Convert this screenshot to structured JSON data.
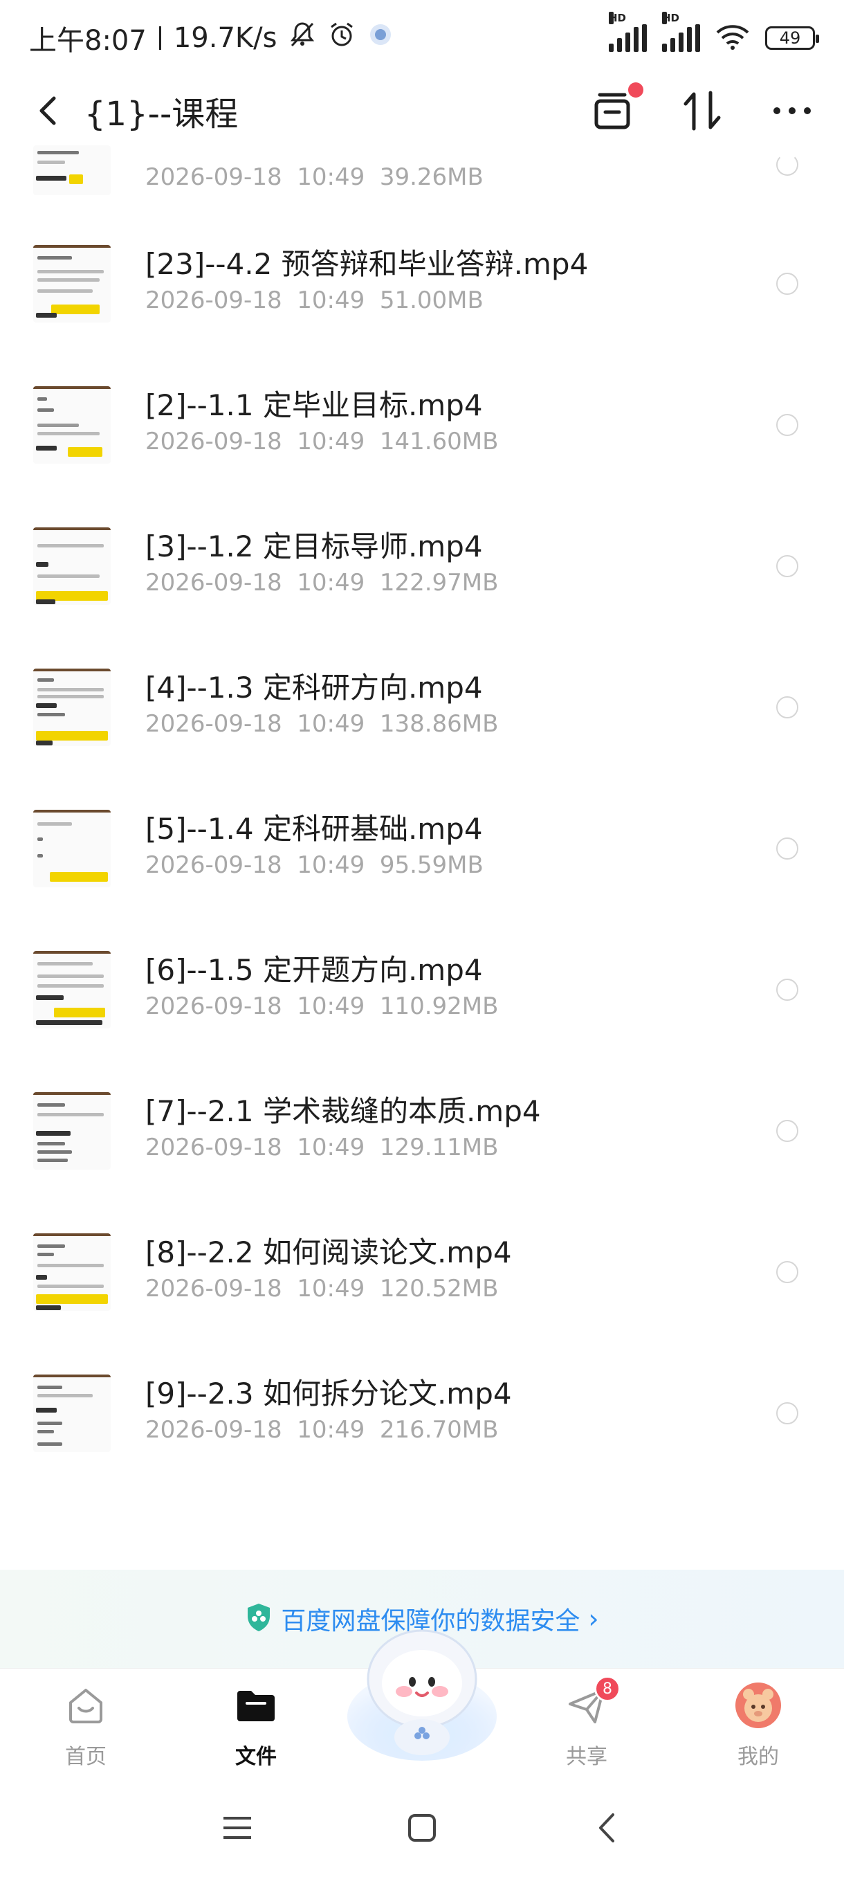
{
  "status_bar": {
    "time": "上午8:07",
    "speed": "19.7K/s",
    "hd1": "HD",
    "hd2": "HD",
    "battery": "49"
  },
  "header": {
    "title": "{1}--课程"
  },
  "files": [
    {
      "name": "",
      "date": "2026-09-18",
      "time": "10:49",
      "size": "39.26MB"
    },
    {
      "name": "[23]--4.2 预答辩和毕业答辩.mp4",
      "date": "2026-09-18",
      "time": "10:49",
      "size": "51.00MB"
    },
    {
      "name": "[2]--1.1 定毕业目标.mp4",
      "date": "2026-09-18",
      "time": "10:49",
      "size": "141.60MB"
    },
    {
      "name": "[3]--1.2 定目标导师.mp4",
      "date": "2026-09-18",
      "time": "10:49",
      "size": "122.97MB"
    },
    {
      "name": "[4]--1.3 定科研方向.mp4",
      "date": "2026-09-18",
      "time": "10:49",
      "size": "138.86MB"
    },
    {
      "name": "[5]--1.4 定科研基础.mp4",
      "date": "2026-09-18",
      "time": "10:49",
      "size": "95.59MB"
    },
    {
      "name": "[6]--1.5 定开题方向.mp4",
      "date": "2026-09-18",
      "time": "10:49",
      "size": "110.92MB"
    },
    {
      "name": "[7]--2.1 学术裁缝的本质.mp4",
      "date": "2026-09-18",
      "time": "10:49",
      "size": "129.11MB"
    },
    {
      "name": "[8]--2.2 如何阅读论文.mp4",
      "date": "2026-09-18",
      "time": "10:49",
      "size": "120.52MB"
    },
    {
      "name": "[9]--2.3 如何拆分论文.mp4",
      "date": "2026-09-18",
      "time": "10:49",
      "size": "216.70MB"
    }
  ],
  "banner": {
    "text": "百度网盘保障你的数据安全",
    "chevron": "›"
  },
  "tabs": [
    {
      "label": "首页",
      "icon": "home-icon"
    },
    {
      "label": "文件",
      "icon": "folder-icon"
    },
    {
      "label": "共享",
      "icon": "share-icon",
      "badge": "8"
    },
    {
      "label": "我的",
      "icon": "avatar-icon"
    }
  ],
  "colors": {
    "accent": "#2d8cf0",
    "badge": "#f04a5a",
    "meta_text": "#a8a8a8"
  }
}
